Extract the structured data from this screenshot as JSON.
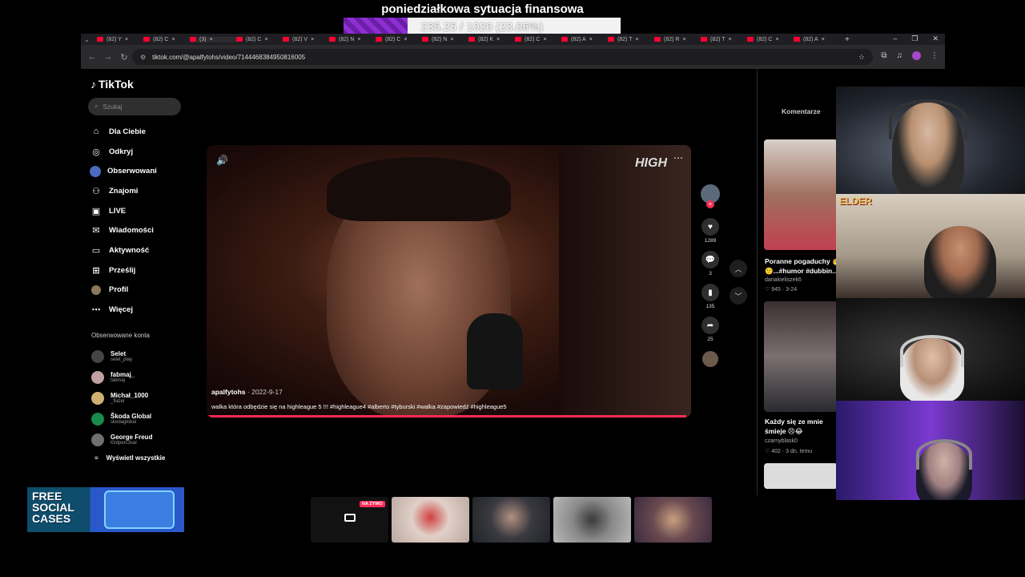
{
  "overlay": {
    "title": "poniedziałkowa sytuacja finansowa",
    "progress_text": "235.25 / 1020 (23.06%)",
    "progress_fraction": 0.2306
  },
  "browser": {
    "tabs": [
      "(82) Y",
      "(82) C",
      "(3) ",
      "(82) C",
      "(82) V",
      "(82) N",
      "(82) C",
      "(82) N",
      "(82) K",
      "(82) C",
      "(82) A",
      "(82) T",
      "(82) R",
      "(82) T",
      "(82) C",
      "(82) A"
    ],
    "url": "tiktok.com/@apalfytohs/video/7144468384950816005"
  },
  "tiktok": {
    "logo": "TikTok",
    "search_placeholder": "Szukaj",
    "nav": [
      {
        "label": "Dla Ciebie",
        "icon": "home-icon"
      },
      {
        "label": "Odkryj",
        "icon": "compass-icon"
      },
      {
        "label": "Obserwowani",
        "icon": "following-avatar-icon"
      },
      {
        "label": "Znajomi",
        "icon": "friends-icon"
      },
      {
        "label": "LIVE",
        "icon": "live-icon"
      },
      {
        "label": "Wiadomości",
        "icon": "messages-icon"
      },
      {
        "label": "Aktywność",
        "icon": "activity-icon"
      },
      {
        "label": "Prześlij",
        "icon": "upload-icon"
      },
      {
        "label": "Profil",
        "icon": "profile-icon"
      },
      {
        "label": "Więcej",
        "icon": "more-icon"
      }
    ],
    "followed_title": "Obserwowane konta",
    "accounts": [
      {
        "name": "Selet",
        "handle": "selet_play"
      },
      {
        "name": "fabmaj_",
        "handle": "fabmaj"
      },
      {
        "name": "Michał_1000",
        "handle": "_flazer"
      },
      {
        "name": "Škoda Global",
        "handle": "skodaglobal"
      },
      {
        "name": "George Freud",
        "handle": "l0rdperc3val"
      }
    ],
    "show_all": "Wyświetl wszystkie"
  },
  "video": {
    "brand": "HIGH",
    "author": "apalfytohs",
    "date": "2022-9-17",
    "caption": "walka która odbędzie się na highleague 5 !!! #highleague4 #alberto #tyburski #walka #zapowiedź #highleague5",
    "progress_fraction": 0.99,
    "likes": "1289",
    "comments": "3",
    "saves": "135",
    "shares": "25"
  },
  "right_panel": {
    "comments_tab": "Komentarze",
    "related": [
      {
        "title": "Poranne pogaduchy 🥳 🙂...#humor #dubbin...",
        "user": "dariakieliszek6",
        "stats": "♡ 945 · 3-24"
      },
      {
        "title": "Każdy się ze mnie śmieje 😣😂",
        "user": "czarnyblask0",
        "stats": "♡ 402 · 3 dn. temu"
      }
    ]
  },
  "webcams": {
    "elder_label": "ELDER"
  },
  "bottom": {
    "live_badge": "NA ŻYWO"
  },
  "ad": {
    "text_line1": "FREE",
    "text_line2": "SOCIAL",
    "text_line3": "CASES"
  }
}
